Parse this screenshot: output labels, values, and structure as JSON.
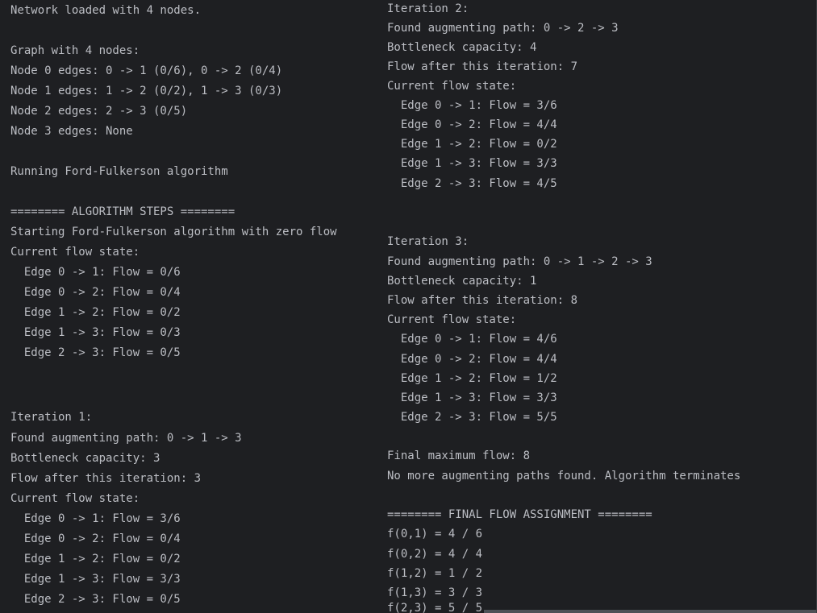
{
  "console": {
    "left_column": [
      "Network loaded with 4 nodes.",
      "",
      "Graph with 4 nodes:",
      "Node 0 edges: 0 -> 1 (0/6), 0 -> 2 (0/4)",
      "Node 1 edges: 1 -> 2 (0/2), 1 -> 3 (0/3)",
      "Node 2 edges: 2 -> 3 (0/5)",
      "Node 3 edges: None",
      "",
      "Running Ford-Fulkerson algorithm",
      "",
      "======== ALGORITHM STEPS ========",
      "Starting Ford-Fulkerson algorithm with zero flow",
      "Current flow state:",
      "  Edge 0 -> 1: Flow = 0/6",
      "  Edge 0 -> 2: Flow = 0/4",
      "  Edge 1 -> 2: Flow = 0/2",
      "  Edge 1 -> 3: Flow = 0/3",
      "  Edge 2 -> 3: Flow = 0/5",
      "",
      "",
      "",
      "Iteration 1:",
      "Found augmenting path: 0 -> 1 -> 3",
      "Bottleneck capacity: 3",
      "Flow after this iteration: 3",
      "Current flow state:",
      "  Edge 0 -> 1: Flow = 3/6",
      "  Edge 0 -> 2: Flow = 0/4",
      "  Edge 1 -> 2: Flow = 0/2",
      "  Edge 1 -> 3: Flow = 3/3",
      "  Edge 2 -> 3: Flow = 0/5"
    ],
    "right_column": [
      "Iteration 2:",
      "Found augmenting path: 0 -> 2 -> 3",
      "Bottleneck capacity: 4",
      "Flow after this iteration: 7",
      "Current flow state:",
      "  Edge 0 -> 1: Flow = 3/6",
      "  Edge 0 -> 2: Flow = 4/4",
      "  Edge 1 -> 2: Flow = 0/2",
      "  Edge 1 -> 3: Flow = 3/3",
      "  Edge 2 -> 3: Flow = 4/5",
      "",
      "",
      "Iteration 3:",
      "Found augmenting path: 0 -> 1 -> 2 -> 3",
      "Bottleneck capacity: 1",
      "Flow after this iteration: 8",
      "Current flow state:",
      "  Edge 0 -> 1: Flow = 4/6",
      "  Edge 0 -> 2: Flow = 4/4",
      "  Edge 1 -> 2: Flow = 1/2",
      "  Edge 1 -> 3: Flow = 3/3",
      "  Edge 2 -> 3: Flow = 5/5",
      "",
      "Final maximum flow: 8",
      "No more augmenting paths found. Algorithm terminates",
      "",
      "======== FINAL FLOW ASSIGNMENT ========",
      "f(0,1) = 4 / 6",
      "f(0,2) = 4 / 4",
      "f(1,2) = 1 / 2",
      "f(1,3) = 3 / 3",
      "f(2,3) = 5 / 5"
    ]
  },
  "colors": {
    "background": "#1e1f22",
    "text": "#bcbec4",
    "scrollbar": "#4e5157"
  }
}
